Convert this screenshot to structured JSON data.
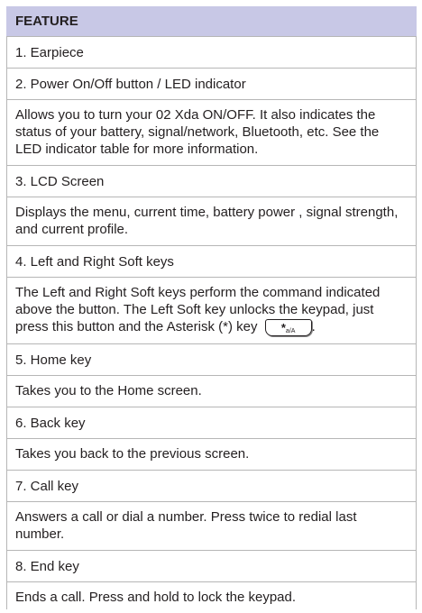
{
  "header": "FEATURE",
  "rows": [
    {
      "title": "1. Earpiece"
    },
    {
      "title": "2. Power On/Off button / LED indicator",
      "desc": "Allows you to turn your 02 Xda ON/OFF. It also indicates the status of your battery, signal/network, Bluetooth, etc. See the LED indicator table for more information."
    },
    {
      "title": "3. LCD Screen",
      "desc": "Displays the menu, current time, battery power , signal strength, and current profile."
    },
    {
      "title": "4. Left and Right Soft keys",
      "desc": "The Left and Right Soft keys perform the command indicated above the button. The Left Soft key unlocks the keypad, just press this button and the Asterisk (*) key"
    },
    {
      "title": "5. Home key",
      "desc": "Takes you to the Home screen."
    },
    {
      "title": "6. Back key",
      "desc": "Takes you back to the previous screen."
    },
    {
      "title": "7. Call key",
      "desc": "Answers a call or dial a number. Press twice to redial last number."
    },
    {
      "title": "8. End key",
      "desc": "Ends a call. Press and hold to lock the keypad."
    }
  ],
  "keycap": {
    "icon": "asterisk-key-icon",
    "symbol": "*",
    "sub": "a/A"
  }
}
